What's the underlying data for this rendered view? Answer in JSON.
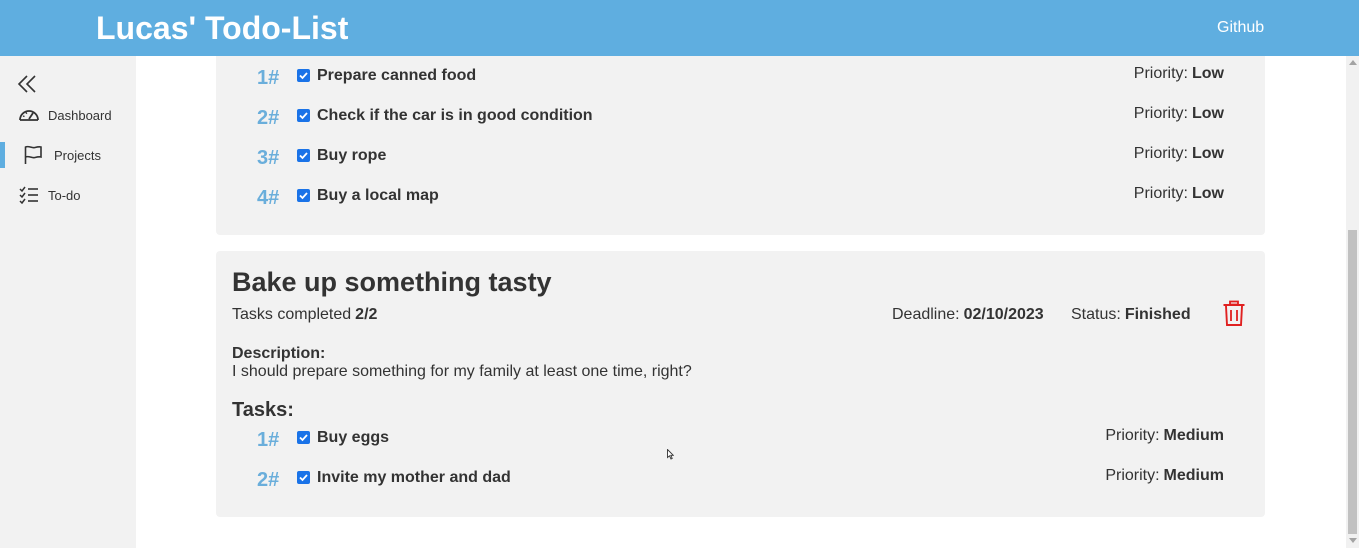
{
  "header": {
    "title": "Lucas' Todo-List",
    "github_label": "Github",
    "color": "#5faee0"
  },
  "sidebar": {
    "collapse_icon": "double-chevron-left-icon",
    "items": [
      {
        "label": "Dashboard",
        "icon": "speedometer-icon"
      },
      {
        "label": "Projects",
        "icon": "flag-icon",
        "active": true
      },
      {
        "label": "To-do",
        "icon": "checklist-icon"
      }
    ]
  },
  "projects": [
    {
      "tasks": [
        {
          "num": "1#",
          "name": "Prepare canned food",
          "checked": true,
          "priority_label": "Priority:",
          "priority": "Low"
        },
        {
          "num": "2#",
          "name": "Check if the car is in good condition",
          "checked": true,
          "priority_label": "Priority:",
          "priority": "Low"
        },
        {
          "num": "3#",
          "name": "Buy rope",
          "checked": true,
          "priority_label": "Priority:",
          "priority": "Low"
        },
        {
          "num": "4#",
          "name": "Buy a local map",
          "checked": true,
          "priority_label": "Priority:",
          "priority": "Low"
        }
      ]
    },
    {
      "title": "Bake up something tasty",
      "tasks_completed_label": "Tasks completed",
      "tasks_completed": "2/2",
      "deadline_label": "Deadline:",
      "deadline": "02/10/2023",
      "status_label": "Status:",
      "status": "Finished",
      "description_label": "Description:",
      "description": "I should prepare something for my family at least one time, right?",
      "tasks_heading": "Tasks:",
      "delete_icon_color": "#e02020",
      "tasks": [
        {
          "num": "1#",
          "name": "Buy eggs",
          "checked": true,
          "priority_label": "Priority:",
          "priority": "Medium"
        },
        {
          "num": "2#",
          "name": "Invite my mother and dad",
          "checked": true,
          "priority_label": "Priority:",
          "priority": "Medium"
        }
      ]
    }
  ]
}
